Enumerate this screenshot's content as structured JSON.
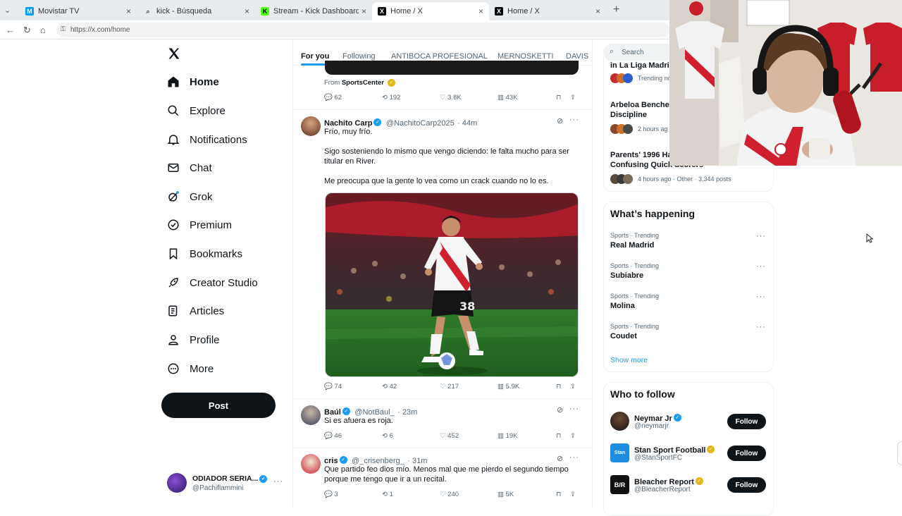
{
  "browser": {
    "tabs": [
      {
        "label": "Movistar TV",
        "icon": "movistar-icon"
      },
      {
        "label": "kick - Búsqueda",
        "icon": "search-icon"
      },
      {
        "label": "Stream - Kick Dashboard",
        "icon": "kick-icon"
      },
      {
        "label": "Home / X",
        "icon": "x-icon"
      },
      {
        "label": "Home / X",
        "icon": "x-icon"
      }
    ],
    "url": "https://x.com/home"
  },
  "nav": {
    "items": [
      {
        "label": "Home",
        "icon": "home-icon"
      },
      {
        "label": "Explore",
        "icon": "search-icon"
      },
      {
        "label": "Notifications",
        "icon": "bell-icon"
      },
      {
        "label": "Chat",
        "icon": "mail-icon"
      },
      {
        "label": "Grok",
        "icon": "grok-icon"
      },
      {
        "label": "Premium",
        "icon": "verified-icon"
      },
      {
        "label": "Bookmarks",
        "icon": "bookmark-icon"
      },
      {
        "label": "Creator Studio",
        "icon": "rocket-icon"
      },
      {
        "label": "Articles",
        "icon": "article-icon"
      },
      {
        "label": "Profile",
        "icon": "person-icon"
      },
      {
        "label": "More",
        "icon": "more-circle-icon"
      }
    ],
    "post_label": "Post",
    "account": {
      "name": "ODIADOR SERIA...",
      "handle": "@Pachiflammini"
    }
  },
  "feed": {
    "tabs": [
      "For you",
      "Following",
      "ANTIBOCA PROFESIONAL",
      "MERNOSKETTI",
      "DAVIS"
    ],
    "from_label": "From",
    "from_source": "SportsCenter",
    "tweets": [
      {
        "name": "",
        "handle": "",
        "time": "",
        "text": [],
        "stats": {
          "replies": "62",
          "reposts": "192",
          "likes": "3.8K",
          "views": "43K"
        }
      },
      {
        "name": "Nachito Carp",
        "handle": "@NachitoCarp2025",
        "time": "· 44m",
        "text": [
          "Frío, muy frío.",
          "Sigo sosteniendo lo mismo que vengo diciendo: le falta mucho para ser titular en River.",
          "Me preocupa que la gente lo vea como un crack cuando no lo es."
        ],
        "stats": {
          "replies": "74",
          "reposts": "42",
          "likes": "217",
          "views": "5.9K"
        }
      },
      {
        "name": "Baúl",
        "handle": "@NotBaul_",
        "time": "· 23m",
        "text": [
          "Si es afuera es roja."
        ],
        "stats": {
          "replies": "46",
          "reposts": "6",
          "likes": "452",
          "views": "19K"
        }
      },
      {
        "name": "cris",
        "handle": "@_crisenberg_",
        "time": "· 31m",
        "text": [
          "Que partido feo dios mío. Menos mal que me pierdo el segundo tiempo porque me tengo que ir a un recital."
        ],
        "stats": {
          "replies": "3",
          "reposts": "1",
          "likes": "240",
          "views": "5K"
        }
      }
    ],
    "image_jersey_number": "38"
  },
  "right": {
    "search_placeholder": "Search",
    "trends_top": [
      {
        "title": "in La Liga Madrid",
        "meta": "Trending no"
      },
      {
        "title": "Arbeloa Benches",
        "title2": "Discipline",
        "meta": "2 hours ag"
      },
      {
        "title": "Parents' 1996 Ha",
        "title2": "Confusing Quick Scorers",
        "meta": "4 hours ago · Other · 3,344 posts"
      }
    ],
    "whats_happening": {
      "heading": "What’s happening",
      "items": [
        {
          "category": "Sports · Trending",
          "title": "Real Madrid"
        },
        {
          "category": "Sports · Trending",
          "title": "Subiabre"
        },
        {
          "category": "Sports · Trending",
          "title": "Molina"
        },
        {
          "category": "Sports · Trending",
          "title": "Coudet"
        }
      ],
      "show_more": "Show more"
    },
    "who_to_follow": {
      "heading": "Who to follow",
      "follow_label": "Follow",
      "accounts": [
        {
          "name": "Neymar Jr",
          "handle": "@neymarjr",
          "badge": "blue"
        },
        {
          "name": "Stan Sport Football",
          "handle": "@StanSportFC",
          "badge": "gold"
        },
        {
          "name": "Bleacher Report",
          "handle": "@BleacherReport",
          "badge": "gold"
        }
      ]
    }
  },
  "colors": {
    "accent": "#1d9bf0",
    "text": "#0f1419",
    "muted": "#536471",
    "river_red": "#d0202e"
  }
}
